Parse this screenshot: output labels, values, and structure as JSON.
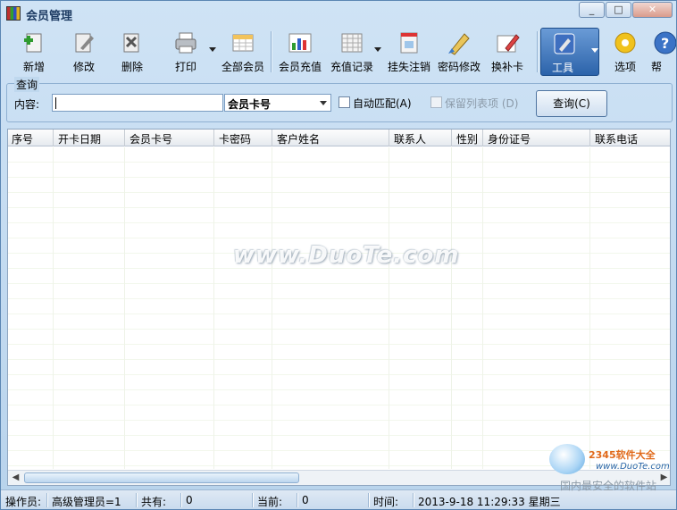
{
  "window": {
    "title": "会员管理",
    "controls": [
      "minimize",
      "maximize",
      "close"
    ]
  },
  "toolbar": {
    "items": [
      {
        "id": "add",
        "label": "新增",
        "icon": "add-user-icon"
      },
      {
        "id": "edit",
        "label": "修改",
        "icon": "edit-icon"
      },
      {
        "id": "delete",
        "label": "删除",
        "icon": "delete-icon"
      },
      {
        "id": "print",
        "label": "打印",
        "icon": "printer-icon"
      },
      {
        "id": "all_members",
        "label": "全部会员",
        "icon": "table-icon"
      },
      {
        "id": "recharge",
        "label": "会员充值",
        "icon": "bar-chart-icon"
      },
      {
        "id": "recharge_log",
        "label": "充值记录",
        "icon": "grid-icon"
      },
      {
        "id": "loss_report",
        "label": "挂失注销",
        "icon": "card-icon"
      },
      {
        "id": "change_password",
        "label": "密码修改",
        "icon": "pencil-icon"
      },
      {
        "id": "replace_card",
        "label": "换补卡",
        "icon": "card-edit-icon"
      },
      {
        "id": "tools",
        "label": "工具",
        "icon": "tools-icon"
      },
      {
        "id": "options",
        "label": "选项",
        "icon": "gear-icon"
      },
      {
        "id": "help",
        "label": "帮",
        "icon": "help-icon"
      }
    ]
  },
  "query": {
    "group_title": "查询",
    "content_label": "内容:",
    "content_value": "",
    "field_select": "会员卡号",
    "auto_match_label": "自动匹配(A)",
    "auto_match_checked": false,
    "keep_columns_label": "保留列表项 (D)",
    "keep_columns_enabled": false,
    "search_button": "查询(C)"
  },
  "grid": {
    "columns": [
      "序号",
      "开卡日期",
      "会员卡号",
      "卡密码",
      "客户姓名",
      "联系人",
      "性别",
      "身份证号",
      "联系电话"
    ],
    "rows": []
  },
  "watermark": "www.DuoTe.com",
  "status": {
    "operator_label": "操作员:",
    "operator_value": "高级管理员=1",
    "total_label": "共有:",
    "total_value": "0",
    "current_label": "当前:",
    "current_value": "0",
    "time_label": "时间:",
    "time_value": "2013-9-18 11:29:33 星期三"
  },
  "overlay_logo": {
    "brand": "2345软件大全",
    "url": "www.DuoTe.com",
    "slogan": "国内最安全的软件站"
  }
}
